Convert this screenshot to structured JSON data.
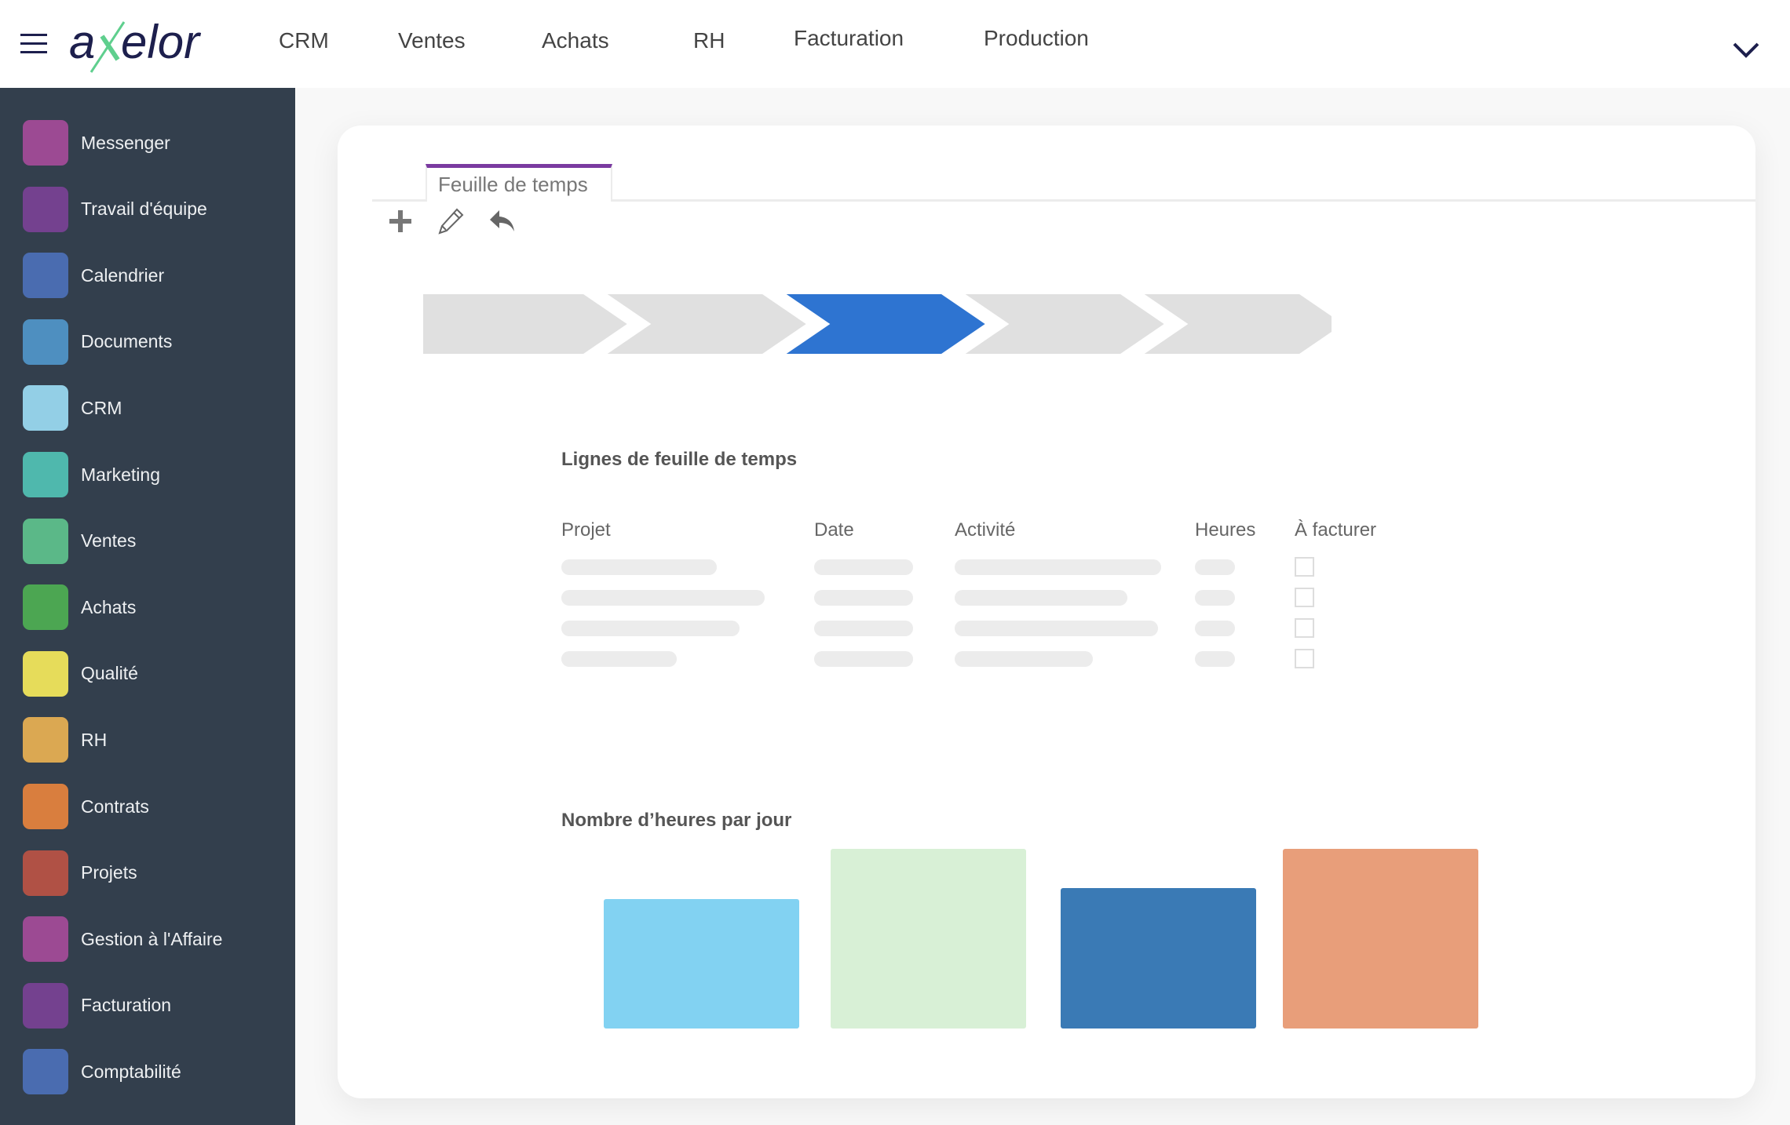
{
  "header": {
    "logo_text": "axelor",
    "nav": [
      "CRM",
      "Ventes",
      "Achats",
      "RH",
      "Facturation",
      "Production"
    ]
  },
  "sidebar": {
    "items": [
      {
        "label": "Messenger",
        "color": "#9c4a93"
      },
      {
        "label": "Travail d'équipe",
        "color": "#74418f"
      },
      {
        "label": "Calendrier",
        "color": "#4a6cb0"
      },
      {
        "label": "Documents",
        "color": "#4e8fc0"
      },
      {
        "label": "CRM",
        "color": "#93cfe6"
      },
      {
        "label": "Marketing",
        "color": "#4fb8ad"
      },
      {
        "label": "Ventes",
        "color": "#5bb888"
      },
      {
        "label": "Achats",
        "color": "#4ca652"
      },
      {
        "label": "Qualité",
        "color": "#e6dc5a"
      },
      {
        "label": "RH",
        "color": "#dba852"
      },
      {
        "label": "Contrats",
        "color": "#d97e3e"
      },
      {
        "label": "Projets",
        "color": "#b05145"
      },
      {
        "label": "Gestion à l'Affaire",
        "color": "#9c4a93"
      },
      {
        "label": "Facturation",
        "color": "#74418f"
      },
      {
        "label": "Comptabilité",
        "color": "#4a6cb0"
      }
    ]
  },
  "main": {
    "tab_label": "Feuille de temps",
    "toolbar": [
      "plus-icon",
      "pencil-icon",
      "undo-icon"
    ],
    "status_steps": {
      "count": 5,
      "active_index": 2,
      "active_color": "#2e74d1",
      "inactive_color": "#e0e0e0"
    },
    "lines_title": "Lignes de feuille de temps",
    "columns": [
      "Projet",
      "Date",
      "Activité",
      "Heures",
      "À facturer"
    ],
    "row_count": 4,
    "chart_title": "Nombre d’heures par jour"
  },
  "chart_data": {
    "type": "bar",
    "values": [
      0.72,
      1.0,
      0.78,
      1.0
    ],
    "colors": [
      "#82d2f2",
      "#d8f0d6",
      "#3a7ab5",
      "#e89e7a"
    ]
  }
}
